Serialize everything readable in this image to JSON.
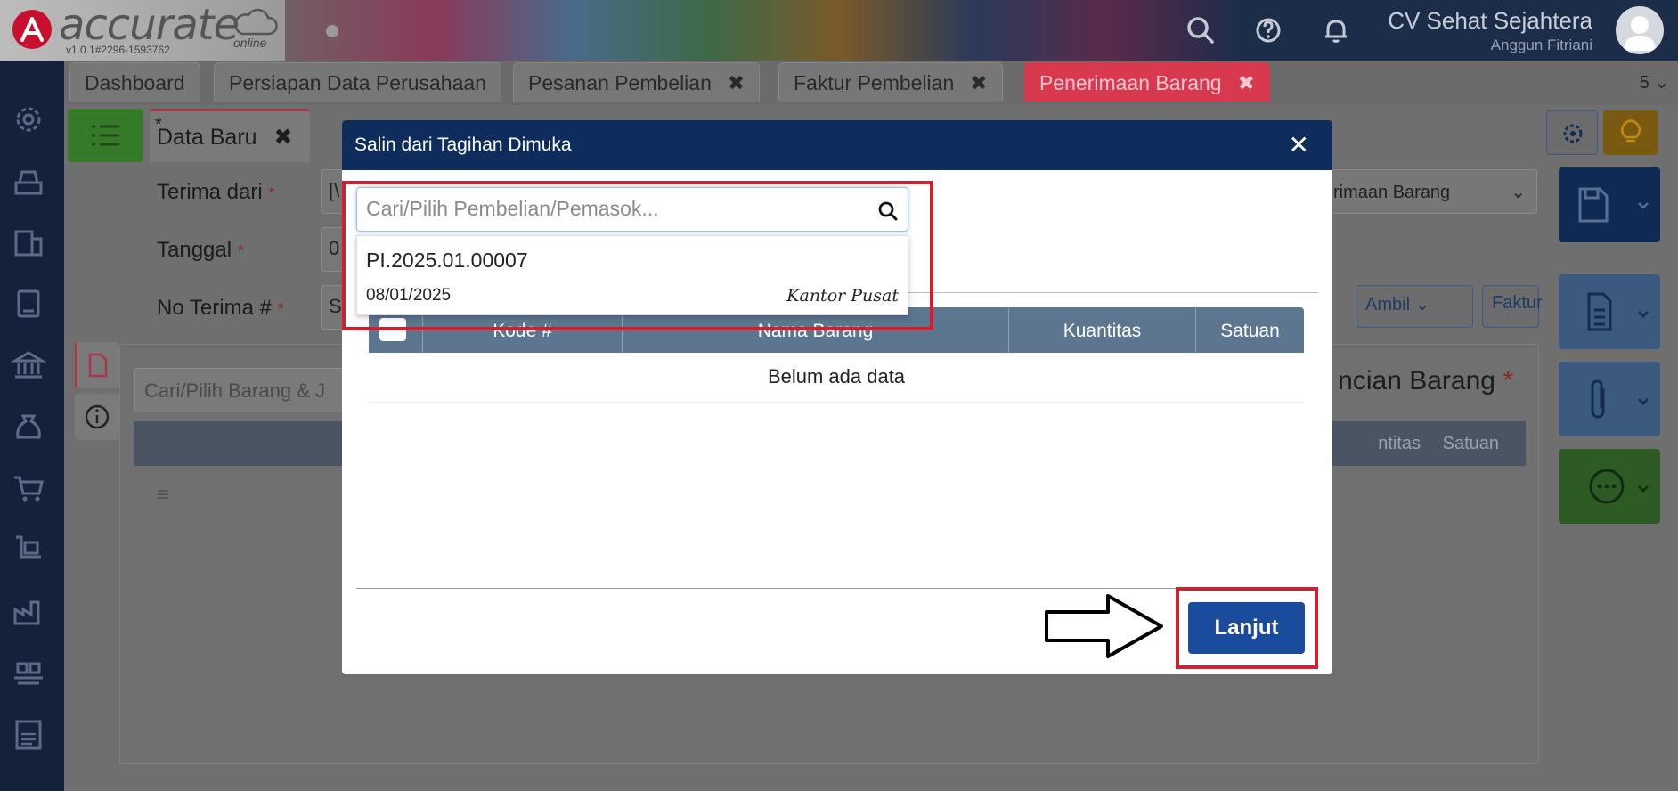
{
  "app": {
    "logo_text": "accurate",
    "logo_sub": "online",
    "version": "v1.0.1#2296-1593762",
    "company_name": "CV Sehat Sejahtera",
    "user_name": "Anggun Fitriani"
  },
  "header_icons": [
    "search-icon",
    "help-icon",
    "bell-icon"
  ],
  "tabs": [
    {
      "label": "Dashboard",
      "closable": false
    },
    {
      "label": "Persiapan Data Perusahaan",
      "closable": false
    },
    {
      "label": "Pesanan Pembelian",
      "closable": true
    },
    {
      "label": "Faktur Pembelian",
      "closable": true
    },
    {
      "label": "Penerimaan Barang",
      "closable": true,
      "active": true
    }
  ],
  "tab_close_glyph": "✖",
  "tab_count": "5 ⌄",
  "form": {
    "subtab_label": "Data Baru",
    "subtab_marker": "*",
    "terima_dari_label": "Terima dari",
    "terima_dari_value": "[\\",
    "tanggal_label": "Tanggal",
    "tanggal_value": "0",
    "no_terima_label": "No Terima #",
    "no_terima_value": "S",
    "required_mark": "*",
    "type_select": "rimaan Barang",
    "ambil_button": "Ambil",
    "faktur_button": "Faktur",
    "item_search_placeholder": "Cari/Pilih Barang & J",
    "section_title": "ncian Barang",
    "col_kuantitas": "ntitas",
    "col_satuan": "Satuan"
  },
  "modal": {
    "title": "Salin dari Tagihan Dimuka",
    "close_glyph": "✕",
    "search_placeholder": "Cari/Pilih Pembelian/Pemasok...",
    "dropdown_item": {
      "number": "PI.2025.01.00007",
      "date": "08/01/2025",
      "location": "Kantor Pusat"
    },
    "columns": [
      "Kode #",
      "Nama Barang",
      "Kuantitas",
      "Satuan"
    ],
    "empty_text": "Belum ada data",
    "next_button": "Lanjut"
  },
  "colors": {
    "modal_header": "#0f2d5c",
    "table_header": "#5d7690",
    "next_button": "#1b4b9c",
    "highlight_box": "#d21f2e",
    "active_tab": "#d9394f",
    "sidebar": "#14213a"
  }
}
